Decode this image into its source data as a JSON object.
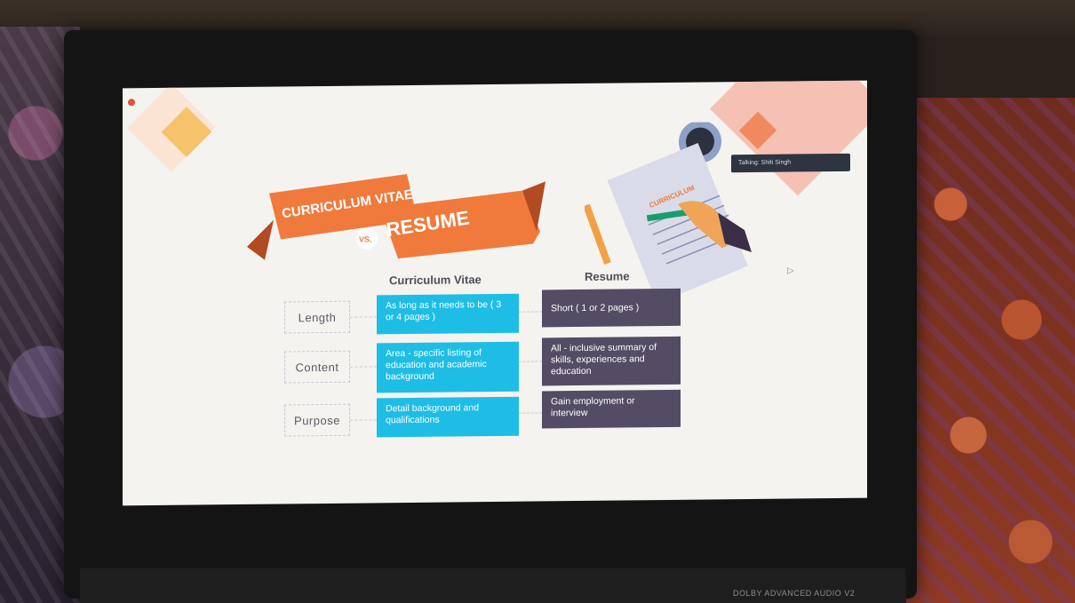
{
  "slide": {
    "recording_indicator": "",
    "talking_label": "Talking: Shiti Singh",
    "title_ribbon_1": "CURRICULUM VITAE",
    "title_vs": "VS.",
    "title_ribbon_2": "RESUME",
    "illustration_text": "CURRICULUM"
  },
  "columns": {
    "cv": "Curriculum Vitae",
    "resume": "Resume"
  },
  "rows": [
    {
      "label": "Length",
      "cv": "As long as it needs to be ( 3 or 4 pages )",
      "resume": "Short ( 1 or 2 pages )"
    },
    {
      "label": "Content",
      "cv": "Area - specific listing of education and academic background",
      "resume": "All - inclusive summary of skills, experiences and education"
    },
    {
      "label": "Purpose",
      "cv": "Detail background and qualifications",
      "resume": "Gain employment or interview"
    }
  ],
  "device": {
    "badge": "DOLBY  ADVANCED AUDIO V2"
  },
  "colors": {
    "ribbon": "#f07a3c",
    "ribbon_dark": "#b24b22",
    "cv_box": "#1ebde6",
    "resume_box": "#534c64",
    "slide_bg": "#f4f3ef"
  },
  "icons": [
    "record-icon",
    "pen-icon",
    "pencil-icon",
    "document-icon",
    "cursor-icon"
  ]
}
